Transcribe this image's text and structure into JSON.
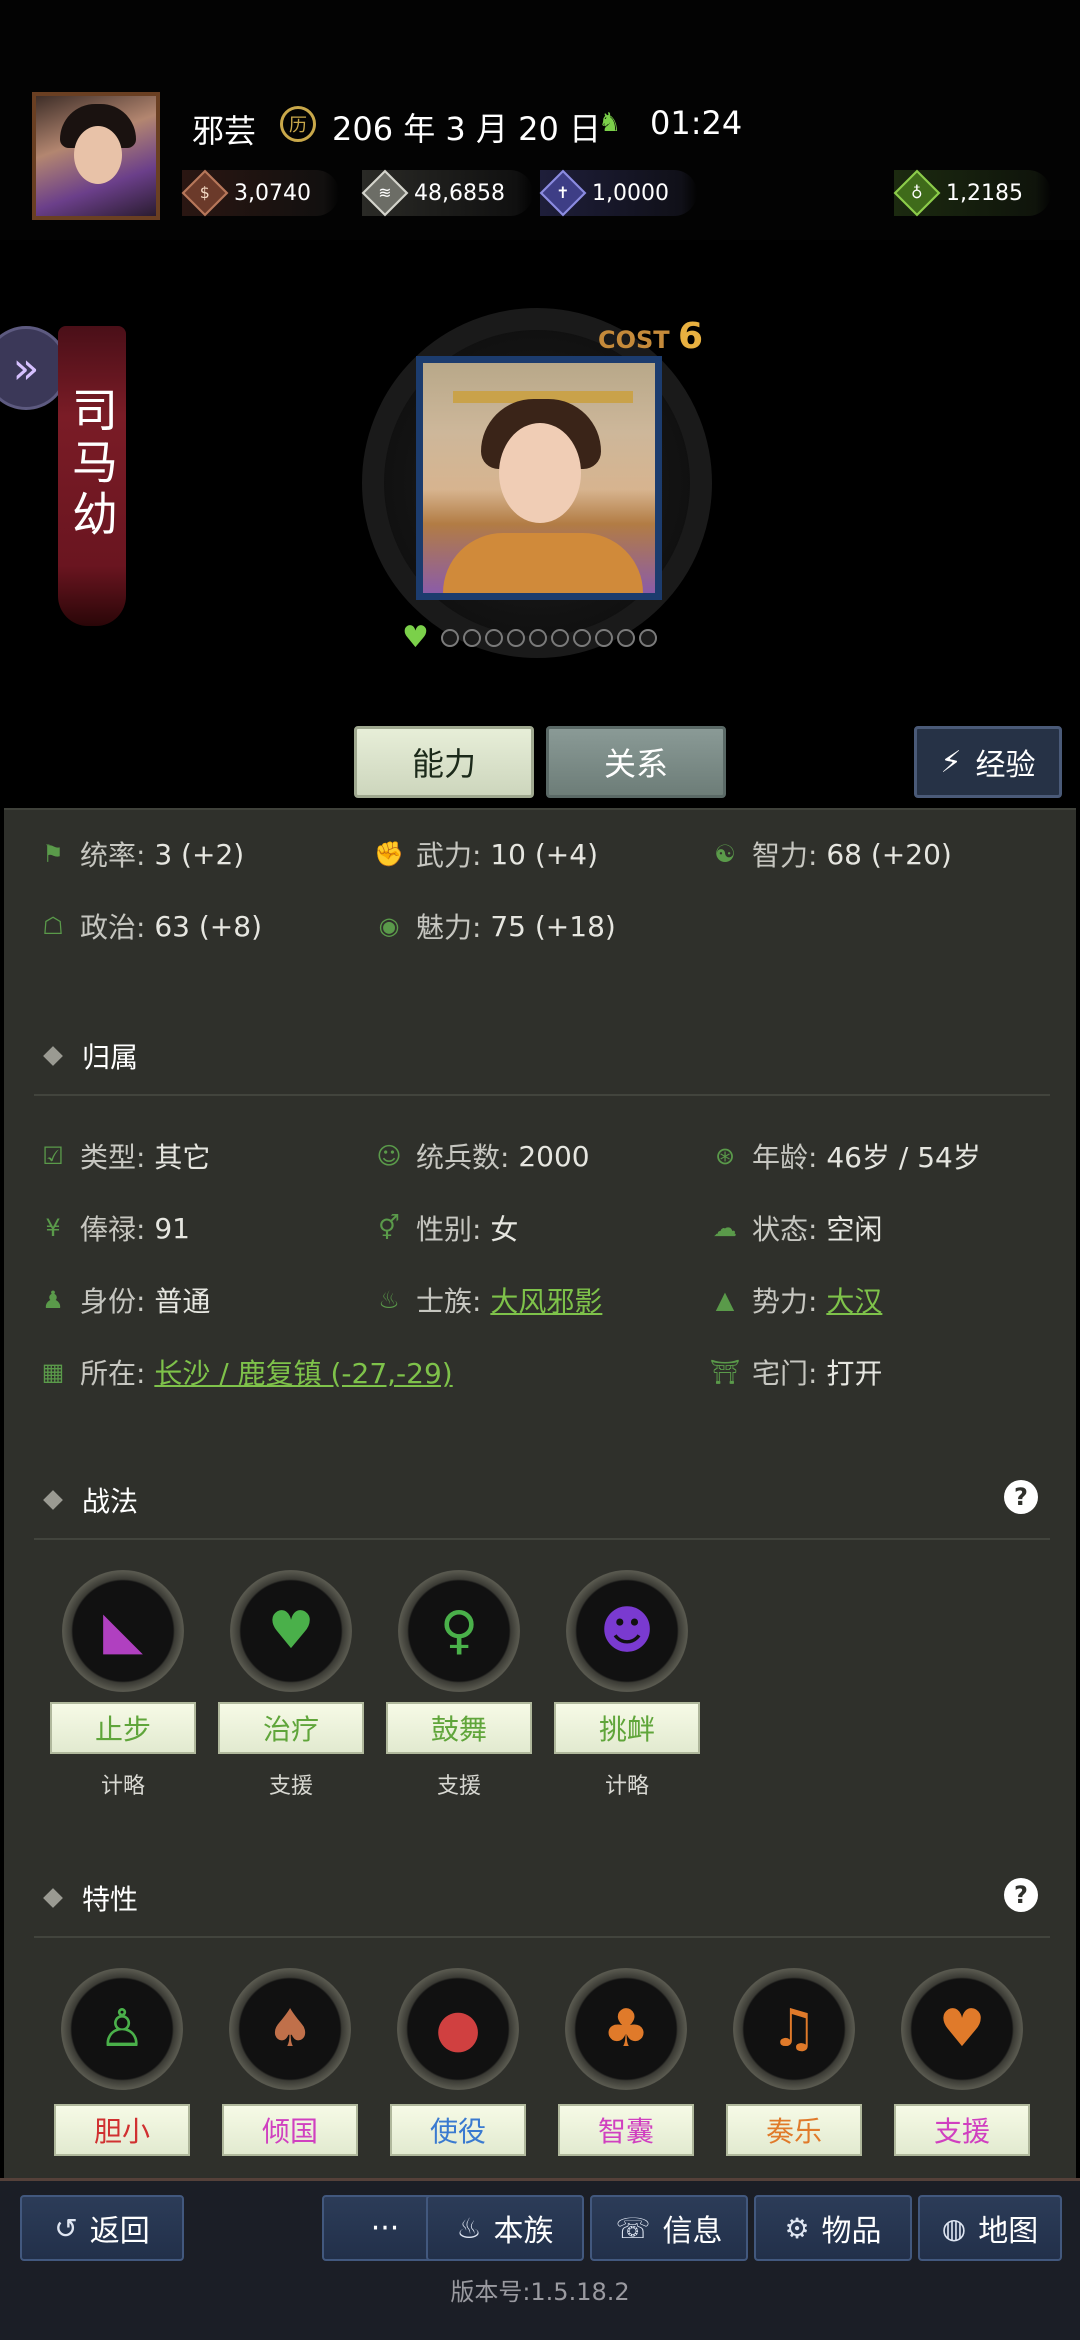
{
  "header": {
    "player_name": "邪芸",
    "date": "206 年 3 月 20 日",
    "time": "01:24",
    "resources": [
      {
        "icon": "coin-icon",
        "value": "3,0740"
      },
      {
        "icon": "grain-icon",
        "value": "48,6858"
      },
      {
        "icon": "soldier-icon",
        "value": "1,0000"
      },
      {
        "icon": "money-bag-icon",
        "value": "1,2185"
      }
    ]
  },
  "hero": {
    "name": "司马幼",
    "cost_label": "COST",
    "cost_value": "6",
    "stars_total": 10,
    "stars_filled": 0
  },
  "tabs": {
    "ability": "能力",
    "relation": "关系",
    "experience": "经验"
  },
  "stats": {
    "command_label": "统率:",
    "command_value": "3 (+2)",
    "force_label": "武力:",
    "force_value": "10 (+4)",
    "intellect_label": "智力:",
    "intellect_value": "68 (+20)",
    "politics_label": "政治:",
    "politics_value": "63 (+8)",
    "charm_label": "魅力:",
    "charm_value": "75 (+18)"
  },
  "affiliation": {
    "title": "归属",
    "type_label": "类型:",
    "type_value": "其它",
    "troops_label": "统兵数:",
    "troops_value": "2000",
    "age_label": "年龄:",
    "age_value": "46岁 / 54岁",
    "salary_label": "俸禄:",
    "salary_value": "91",
    "gender_label": "性别:",
    "gender_value": "女",
    "status_label": "状态:",
    "status_value": "空闲",
    "identity_label": "身份:",
    "identity_value": "普通",
    "clan_label": "士族:",
    "clan_value": "大风邪影",
    "faction_label": "势力:",
    "faction_value": "大汉",
    "location_label": "所在:",
    "location_value": "长沙 / 鹿复镇 (-27,-29)",
    "house_label": "宅门:",
    "house_value": "打开"
  },
  "tactics": {
    "title": "战法",
    "items": [
      {
        "name": "止步",
        "type": "计略",
        "icon": "boot-icon"
      },
      {
        "name": "治疗",
        "type": "支援",
        "icon": "heal-heart-icon"
      },
      {
        "name": "鼓舞",
        "type": "支援",
        "icon": "inspire-icon"
      },
      {
        "name": "挑衅",
        "type": "计略",
        "icon": "taunt-icon"
      }
    ]
  },
  "traits": {
    "title": "特性",
    "items": [
      {
        "name": "胆小",
        "icon": "kneel-icon",
        "color": "#d03030"
      },
      {
        "name": "倾国",
        "icon": "ballet-shoe-icon",
        "color": "#d040c0"
      },
      {
        "name": "使役",
        "icon": "boulder-icon",
        "color": "#3a7ad0"
      },
      {
        "name": "智囊",
        "icon": "bag-icon",
        "color": "#d040c0"
      },
      {
        "name": "奏乐",
        "icon": "music-icon",
        "color": "#e07a2a"
      },
      {
        "name": "支援",
        "icon": "stitched-heart-icon",
        "color": "#d040c0"
      }
    ]
  },
  "bottom_nav": {
    "back": "返回",
    "more": "···",
    "clan": "本族",
    "info": "信息",
    "items": "物品",
    "map": "地图"
  },
  "version": "版本号:1.5.18.2"
}
